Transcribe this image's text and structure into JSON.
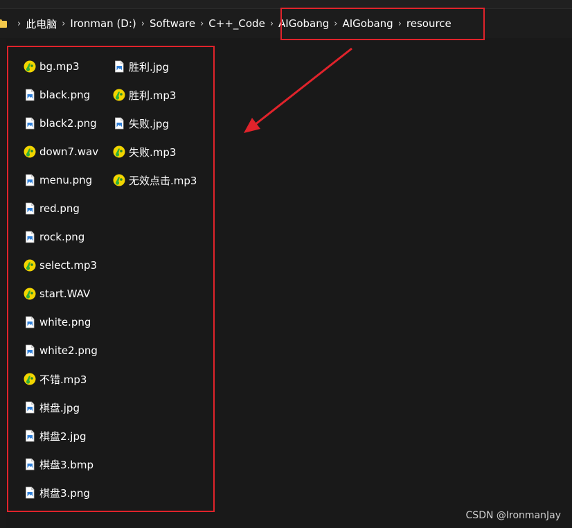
{
  "breadcrumb": {
    "items": [
      "此电脑",
      "Ironman (D:)",
      "Software",
      "C++_Code",
      "AIGobang",
      "AIGobang",
      "resource"
    ],
    "separator": "›"
  },
  "files": {
    "column1": [
      {
        "name": "bg.mp3",
        "icon": "audio-file-icon"
      },
      {
        "name": "black.png",
        "icon": "image-file-icon"
      },
      {
        "name": "black2.png",
        "icon": "image-file-icon"
      },
      {
        "name": "down7.wav",
        "icon": "audio-file-icon"
      },
      {
        "name": "menu.png",
        "icon": "image-file-icon"
      },
      {
        "name": "red.png",
        "icon": "image-file-icon"
      },
      {
        "name": "rock.png",
        "icon": "image-file-icon"
      },
      {
        "name": "select.mp3",
        "icon": "audio-file-icon"
      },
      {
        "name": "start.WAV",
        "icon": "audio-file-icon"
      },
      {
        "name": "white.png",
        "icon": "image-file-icon"
      },
      {
        "name": "white2.png",
        "icon": "image-file-icon"
      },
      {
        "name": "不错.mp3",
        "icon": "audio-file-icon"
      },
      {
        "name": "棋盘.jpg",
        "icon": "image-file-icon"
      },
      {
        "name": "棋盘2.jpg",
        "icon": "image-file-icon"
      },
      {
        "name": "棋盘3.bmp",
        "icon": "image-file-icon"
      },
      {
        "name": "棋盘3.png",
        "icon": "image-file-icon"
      }
    ],
    "column2": [
      {
        "name": "胜利.jpg",
        "icon": "image-file-icon"
      },
      {
        "name": "胜利.mp3",
        "icon": "audio-file-icon"
      },
      {
        "name": "失败.jpg",
        "icon": "image-file-icon"
      },
      {
        "name": "失败.mp3",
        "icon": "audio-file-icon"
      },
      {
        "name": "无效点击.mp3",
        "icon": "audio-file-icon"
      }
    ]
  },
  "watermark": "CSDN @IronmanJay",
  "colors": {
    "background": "#191919",
    "annotation": "#e0232b",
    "audio_icon_yellow": "#f2d500",
    "audio_icon_green": "#2fae3a",
    "image_icon_blue": "#2f7fd8"
  }
}
